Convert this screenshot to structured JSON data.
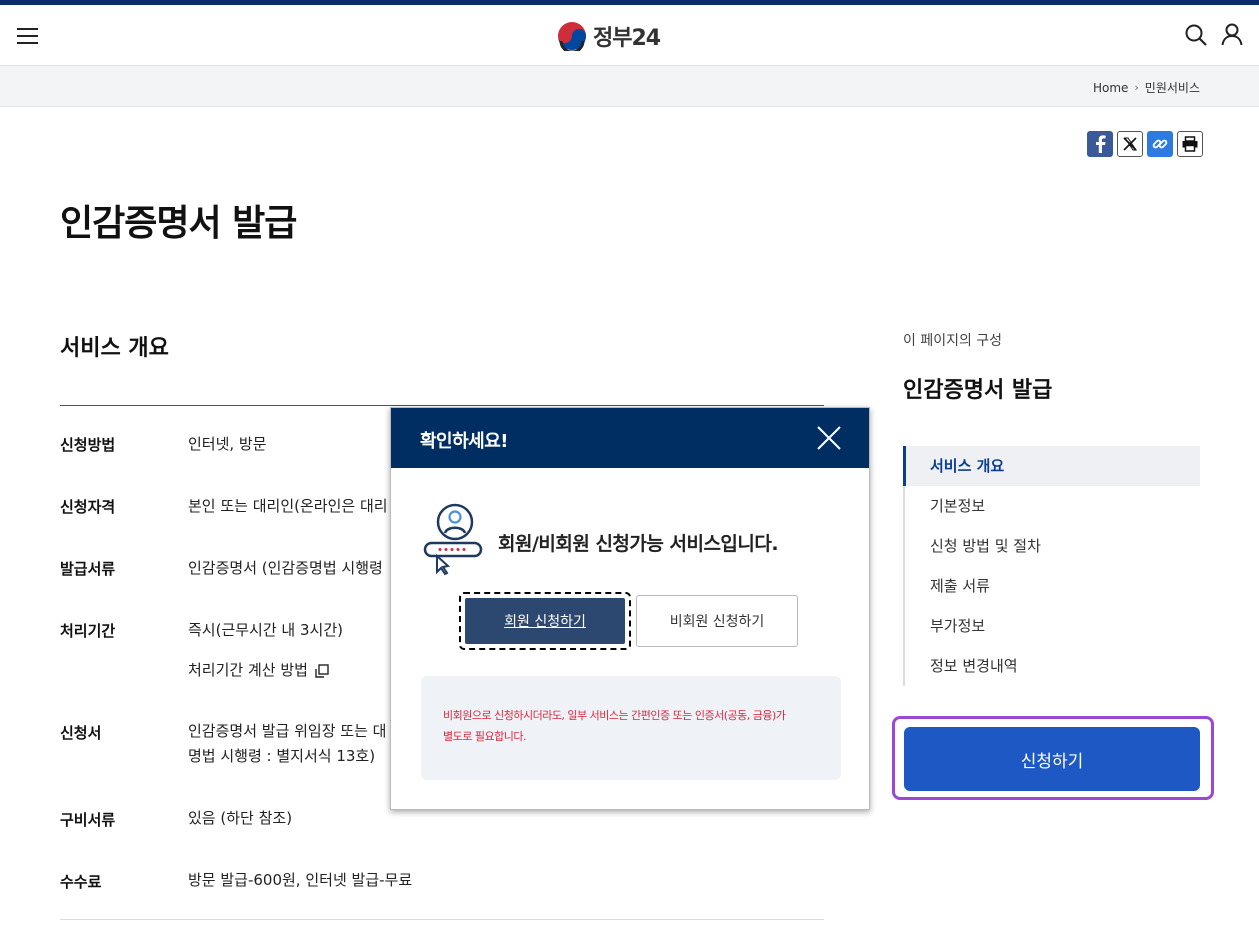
{
  "header": {
    "logo_text": "정부24",
    "icons": {
      "menu": "hamburger-menu-icon",
      "search": "search-icon",
      "user": "user-icon",
      "logo": "taegeuk-logo-icon"
    }
  },
  "breadcrumb": {
    "home": "Home",
    "current": "민원서비스"
  },
  "share": {
    "icons": [
      "facebook-icon",
      "x-icon",
      "link-icon",
      "print-icon"
    ]
  },
  "page_title": "인감증명서 발급",
  "overview": {
    "title": "서비스 개요",
    "rows": [
      {
        "label": "신청방법",
        "value": "인터넷, 방문"
      },
      {
        "label": "신청자격",
        "value": "본인 또는 대리인(온라인은 대리"
      },
      {
        "label": "발급서류",
        "value": "인감증명서 (인감증명법 시행령"
      },
      {
        "label": "처리기간",
        "value": "즉시(근무시간 내 3시간)",
        "sub": "처리기간 계산 방법"
      },
      {
        "label": "신청서",
        "value": "인감증명서 발급 위임장 또는 대",
        "value2": "명법 시행령 : 별지서식 13호)"
      },
      {
        "label": "구비서류",
        "value": "있음 (하단 참조)"
      },
      {
        "label": "수수료",
        "value": "방문 발급-600원, 인터넷 발급-무료"
      }
    ]
  },
  "toc": {
    "caption": "이 페이지의 구성",
    "title": "인감증명서 발급",
    "items": [
      "서비스 개요",
      "기본정보",
      "신청 방법 및 절차",
      "제출 서류",
      "부가정보",
      "정보 변경내역"
    ],
    "active_index": 0
  },
  "apply_button": "신청하기",
  "modal": {
    "title": "확인하세요!",
    "message": "회원/비회원 신청가능 서비스입니다.",
    "member_button": "회원 신청하기",
    "guest_button": "비회원 신청하기",
    "notice_line1": "비회원으로 신청하시더라도, 일부 서비스는 간편인증 또는 인증서(공동, 금융)가",
    "notice_line2": "별도로 필요합니다.",
    "icons": {
      "close": "close-icon",
      "illustration": "user-password-icon"
    }
  },
  "colors": {
    "navy": "#002d62",
    "primary": "#1d58c4",
    "focus_outline": "#9b49d4",
    "notice_red": "#e0253b"
  }
}
